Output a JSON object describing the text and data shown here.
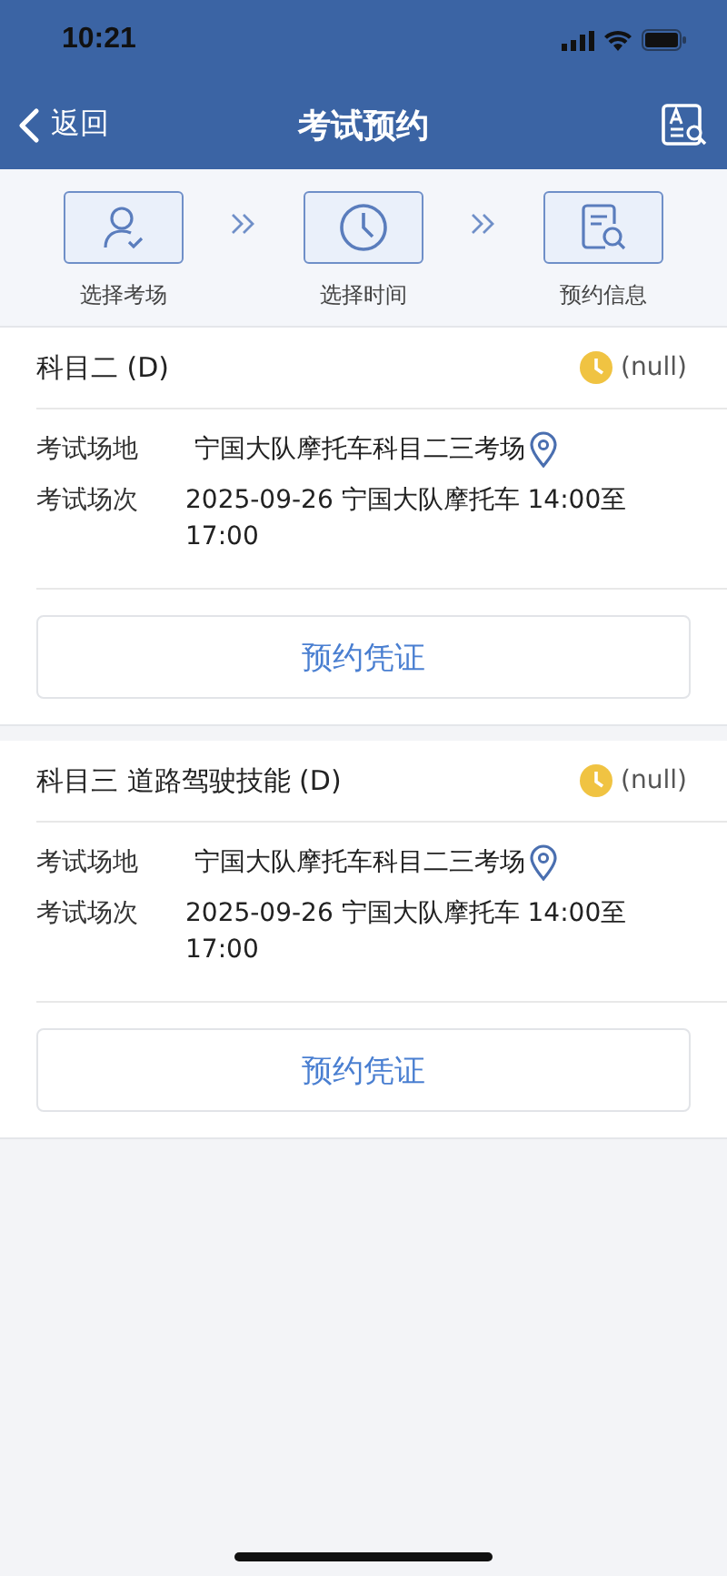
{
  "status_bar": {
    "time": "10:21"
  },
  "nav": {
    "back": "返回",
    "title": "考试预约"
  },
  "steps": [
    {
      "kind": "person",
      "label": "选择考场"
    },
    {
      "kind": "clock",
      "label": "选择时间"
    },
    {
      "kind": "document",
      "label": "预约信息"
    }
  ],
  "cards": [
    {
      "subject": "科目二 (D)",
      "status": "(null)",
      "fields": [
        {
          "label": "考试场地",
          "value": "宁国大队摩托车科目二三考场",
          "kind": "location"
        },
        {
          "label": "考试场次",
          "value": "2025-09-26 宁国大队摩托车 14:00至17:00",
          "kind": "text"
        }
      ],
      "button": "预约凭证"
    },
    {
      "subject": "科目三 道路驾驶技能 (D)",
      "status": "(null)",
      "fields": [
        {
          "label": "考试场地",
          "value": "宁国大队摩托车科目二三考场",
          "kind": "location"
        },
        {
          "label": "考试场次",
          "value": "2025-09-26 宁国大队摩托车 14:00至17:00",
          "kind": "text"
        }
      ],
      "button": "预约凭证"
    }
  ]
}
